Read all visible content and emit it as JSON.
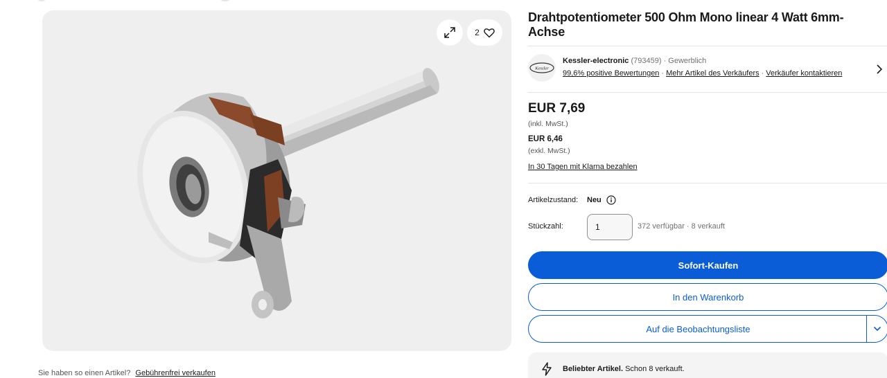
{
  "listing": {
    "title": "Drahtpotentiometer 500 Ohm Mono linear 4 Watt 6mm-Achse",
    "image_alt": "Drahtpotentiometer",
    "watch_count": "2"
  },
  "seller": {
    "logo_text": "Kessler",
    "name": "Kessler-electronic",
    "feedback_count": "(793459)",
    "type": "· Gewerblich",
    "positive": "99,6% positive Bewertungen",
    "more_items": "Mehr Artikel des Verkäufers",
    "contact": "Verkäufer kontaktieren",
    "separator": "·"
  },
  "price": {
    "main": "EUR 7,69",
    "main_note": "(inkl. MwSt.)",
    "net": "EUR 6,46",
    "net_note": "(exkl. MwSt.)",
    "klarna": "In 30 Tagen mit Klarna bezahlen"
  },
  "condition": {
    "label": "Artikelzustand:",
    "value": "Neu"
  },
  "quantity": {
    "label": "Stückzahl:",
    "value": "1",
    "availability": "372 verfügbar · 8 verkauft"
  },
  "actions": {
    "buy_now": "Sofort-Kaufen",
    "add_to_cart": "In den Warenkorb",
    "watchlist": "Auf die Beobachtungsliste"
  },
  "popular": {
    "bold": "Beliebter Artikel.",
    "text": " Schon 8 verkauft."
  },
  "sell_prompt": {
    "question": "Sie haben so einen Artikel?",
    "link": "Gebührenfrei verkaufen"
  },
  "colors": {
    "primary": "#0a5dd6",
    "panel": "#efefef"
  },
  "icons": [
    "expand-icon",
    "heart-icon",
    "chevron-right-icon",
    "info-icon",
    "chevron-down-icon",
    "lightning-icon"
  ]
}
